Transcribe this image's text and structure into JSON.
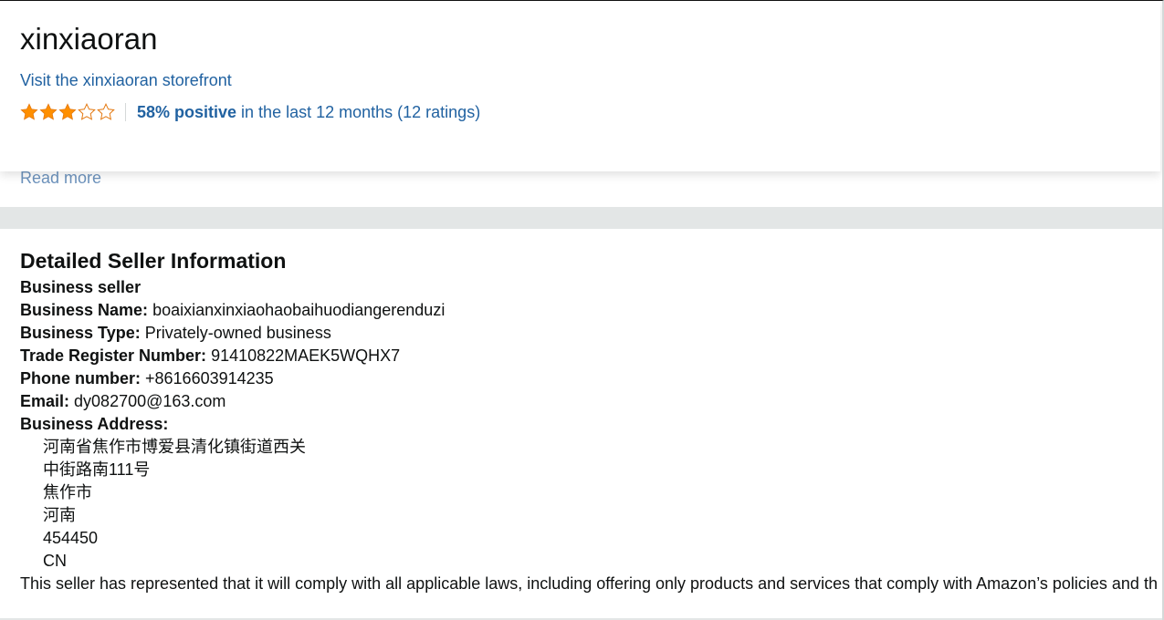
{
  "header": {
    "seller_name": "xinxiaoran",
    "storefront_link": "Visit the xinxiaoran storefront",
    "rating": {
      "stars_filled": 3,
      "stars_total": 5,
      "positive_label": "58% positive",
      "period_text": " in the last 12 months (12 ratings)"
    },
    "colors": {
      "link": "#2162a1",
      "star": "#ff8f00"
    }
  },
  "about": {
    "read_more": "Read more"
  },
  "details": {
    "title": "Detailed Seller Information",
    "business_seller": "Business seller",
    "business_name_label": "Business Name:",
    "business_name_value": " boaixianxinxiaohaobaihuodiangerenduzi",
    "business_type_label": "Business Type:",
    "business_type_value": " Privately-owned business",
    "trade_register_label": "Trade Register Number:",
    "trade_register_value": " 91410822MAEK5WQHX7",
    "phone_label": "Phone number:",
    "phone_value": " +8616603914235",
    "email_label": "Email:",
    "email_value": " dy082700@163.com",
    "address_label": "Business Address:",
    "address_lines": [
      "河南省焦作市博爱县清化镇街道西关",
      "中街路南111号",
      "焦作市",
      "河南",
      "454450",
      "CN"
    ],
    "compliance": "This seller has represented that it will comply with all applicable laws, including offering only products and services that comply with Amazon’s policies and th"
  }
}
